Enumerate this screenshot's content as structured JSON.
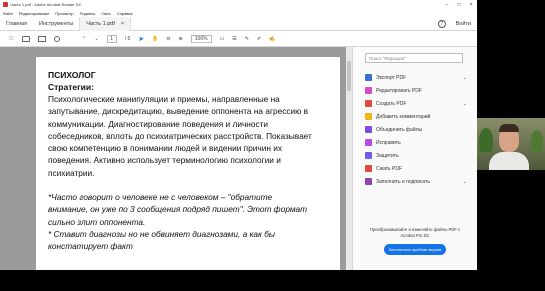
{
  "window": {
    "title": "Часть 1.pdf - Adobe Acrobat Reader DC"
  },
  "menubar": {
    "items": [
      "Файл",
      "Редактирование",
      "Просмотр",
      "Подпись",
      "Окно",
      "Справка"
    ]
  },
  "tabs": {
    "home": "Главная",
    "tools": "Инструменты",
    "document": "Часть 1.pdf",
    "document_close": "×",
    "help": "?",
    "signin": "Войти"
  },
  "toolbar": {
    "page_current": "1",
    "page_total": "/ 5",
    "zoom": "106%"
  },
  "document": {
    "heading": "ПСИХОЛОГ",
    "subheading": "Стратегии:",
    "para1_lines": [
      "Психологические манипуляции и приемы, направленные на",
      "запутывание, дискредитацию, выведение оппонента на агрессию в",
      "коммуникации. Диагностирование поведения и личности",
      "собеседников, вплоть до психиатрических расстройств. Показывает",
      "свою компетенцию в понимании людей и видении причин их",
      "поведения. Активно использует терминологию психологии и",
      "психиатрии."
    ],
    "italic_lines": [
      "*Часто говорит о человеке не с человеком – \"обратите",
      "внимание, он уже по 3 сообщения подряд пишет\". Этот формат",
      "сильно злит оппонента.",
      "* Ставит диагнозы но не обвиняет диагнозами, а как бы",
      "констатирует факт"
    ]
  },
  "right_pane": {
    "search_placeholder": "Поиск \"Редакция\"",
    "tools": [
      {
        "label": "Экспорт PDF",
        "color": "#3a6fd8",
        "chevron": "⌄"
      },
      {
        "label": "Редактировать PDF",
        "color": "#d64cc4",
        "chevron": ""
      },
      {
        "label": "Создать PDF",
        "color": "#e0493c",
        "chevron": "⌄"
      },
      {
        "label": "Добавить комментарий",
        "color": "#f1b514",
        "chevron": ""
      },
      {
        "label": "Объединить файлы",
        "color": "#7b4de0",
        "chevron": ""
      },
      {
        "label": "Исправить",
        "color": "#b64de0",
        "chevron": ""
      },
      {
        "label": "Защитить",
        "color": "#6c5ce7",
        "chevron": ""
      },
      {
        "label": "Сжать PDF",
        "color": "#e0493c",
        "chevron": ""
      },
      {
        "label": "Заполнить и подписать",
        "color": "#8e44ad",
        "chevron": "⌄"
      }
    ],
    "promo_text": "Преобразовывайте и изменяйте файлы PDF с Acrobat Pro DC",
    "promo_button": "Бесплатная пробная версия"
  }
}
